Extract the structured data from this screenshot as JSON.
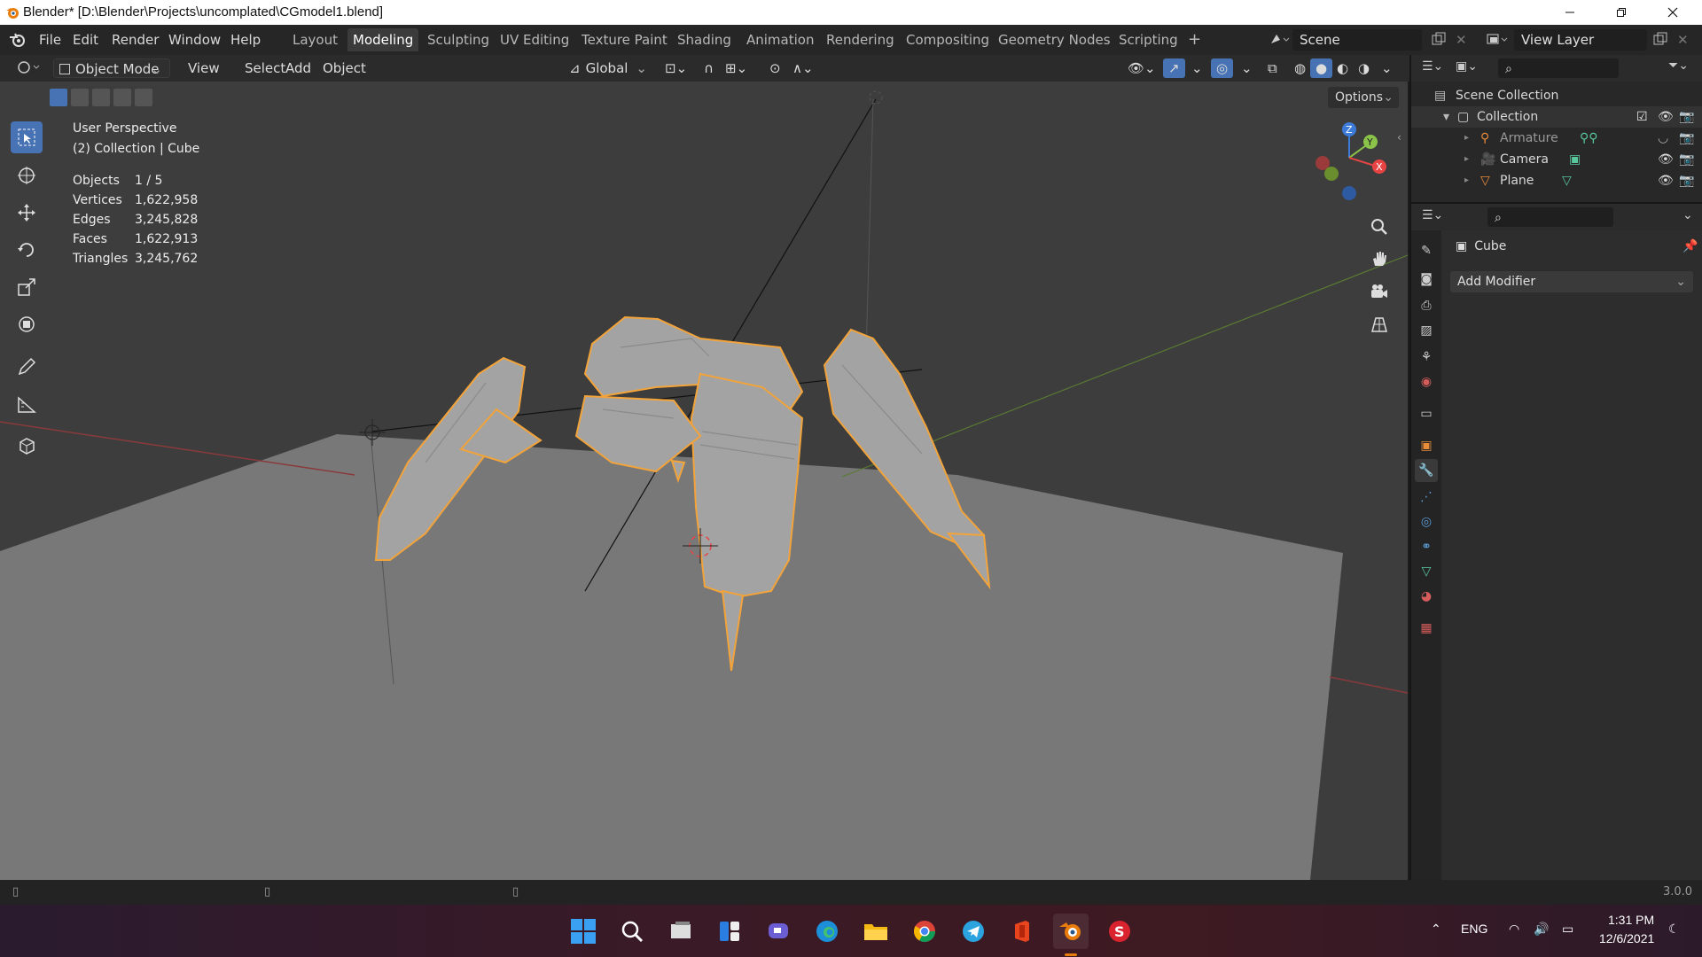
{
  "window": {
    "title": "Blender* [D:\\Blender\\Projects\\uncomplated\\CGmodel1.blend]"
  },
  "menu": [
    "File",
    "Edit",
    "Render",
    "Window",
    "Help"
  ],
  "workspaces": [
    "Layout",
    "Modeling",
    "Sculpting",
    "UV Editing",
    "Texture Paint",
    "Shading",
    "Animation",
    "Rendering",
    "Compositing",
    "Geometry Nodes",
    "Scripting"
  ],
  "active_workspace": "Modeling",
  "scene": {
    "label": "Scene",
    "view_layer": "View Layer"
  },
  "viewport_header": {
    "mode": "Object Mode",
    "menus": [
      "View",
      "Select",
      "Add",
      "Object"
    ],
    "orientation": "Global",
    "options_label": "Options"
  },
  "overlay": {
    "perspective": "User Perspective",
    "collection_line": "(2) Collection | Cube",
    "stats": [
      {
        "label": "Objects",
        "value": "1 / 5"
      },
      {
        "label": "Vertices",
        "value": "1,622,958"
      },
      {
        "label": "Edges",
        "value": "3,245,828"
      },
      {
        "label": "Faces",
        "value": "1,622,913"
      },
      {
        "label": "Triangles",
        "value": "3,245,762"
      }
    ]
  },
  "gizmo": {
    "z": "Z",
    "y": "Y",
    "x": "X"
  },
  "outliner": {
    "root": "Scene Collection",
    "collection": "Collection",
    "items": [
      "Armature",
      "Camera",
      "Plane"
    ]
  },
  "properties": {
    "object": "Cube",
    "add_modifier": "Add Modifier"
  },
  "status": {
    "version": "3.0.0"
  },
  "taskbar": {
    "lang": "ENG",
    "time": "1:31 PM",
    "date": "12/6/2021"
  },
  "colors": {
    "selection_outline": "#f2a33a",
    "active_tab": "#4772b3",
    "viewport_bg": "#3d3d3d"
  }
}
